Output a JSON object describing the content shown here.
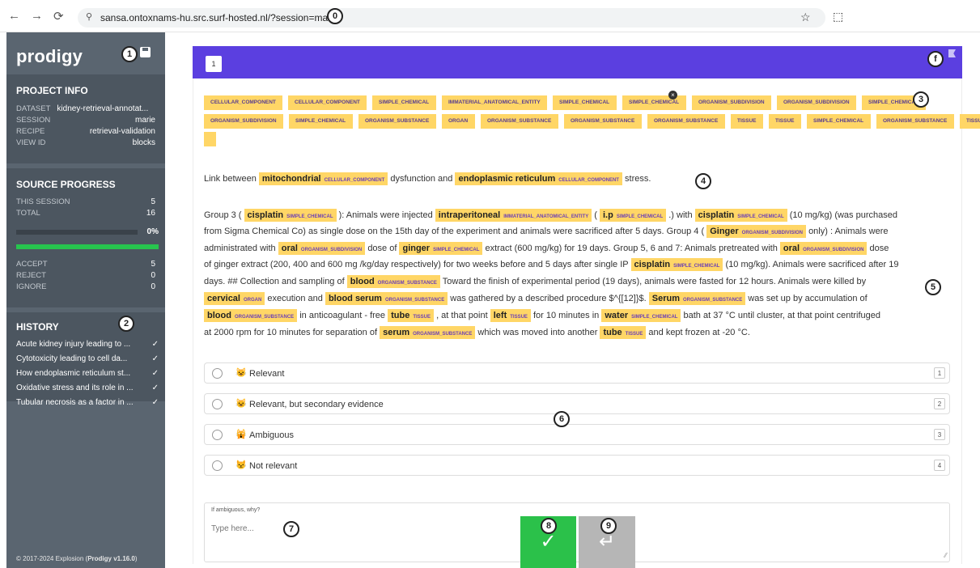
{
  "browser": {
    "url": "sansa.ontoxnams-hu.src.surf-hosted.nl/?session=marie",
    "back": "←",
    "forward": "→",
    "reload": "⟳",
    "site_icon": "⚲",
    "star": "☆",
    "ext": "⬚"
  },
  "markers": [
    "0",
    "1",
    "2",
    "3",
    "4",
    "5",
    "6",
    "7",
    "8",
    "9",
    "f"
  ],
  "sidebar": {
    "logo": "prodigy",
    "project_info": {
      "title": "PROJECT INFO",
      "rows": [
        {
          "k": "DATASET",
          "v": "kidney-retrieval-annotat..."
        },
        {
          "k": "SESSION",
          "v": "marie"
        },
        {
          "k": "RECIPE",
          "v": "retrieval-validation"
        },
        {
          "k": "VIEW ID",
          "v": "blocks"
        }
      ]
    },
    "source_progress": {
      "title": "SOURCE PROGRESS",
      "this_session_label": "THIS SESSION",
      "this_session": "5",
      "total_label": "TOTAL",
      "total": "16",
      "percent": "0%",
      "accept_label": "ACCEPT",
      "accept": "5",
      "reject_label": "REJECT",
      "reject": "0",
      "ignore_label": "IGNORE",
      "ignore": "0"
    },
    "history": {
      "title": "HISTORY",
      "items": [
        "Acute kidney injury leading to ...",
        "Cytotoxicity leading to cell da...",
        "How endoplasmic reticulum st...",
        "Oxidative stress and its role in ...",
        "Tubular necrosis as a factor in ..."
      ],
      "check": "✓"
    },
    "footer_prefix": "© 2017-2024 Explosion",
    "footer_version": "Prodigy v1.16.0"
  },
  "main": {
    "page": "1",
    "labels_row1": [
      "CELLULAR_COMPONENT",
      "CELLULAR_COMPONENT",
      "SIMPLE_CHEMICAL",
      "IMMATERIAL_ANATOMICAL_ENTITY",
      "SIMPLE_CHEMICAL",
      "SIMPLE_CHEMICAL",
      "ORGANISM_SUBDIVISION",
      "ORGANISM_SUBDIVISION",
      "SIMPLE_CHEMICAL"
    ],
    "labels_row2": [
      "ORGANISM_SUBDIVISION",
      "SIMPLE_CHEMICAL",
      "ORGANISM_SUBSTANCE",
      "ORGAN",
      "ORGANISM_SUBSTANCE",
      "ORGANISM_SUBSTANCE",
      "ORGANISM_SUBSTANCE",
      "TISSUE",
      "TISSUE",
      "SIMPLE_CHEMICAL",
      "ORGANISM_SUBSTANCE",
      "TISSUE"
    ],
    "close_glyph": "×",
    "title": {
      "t1": "Link between",
      "e1": "mitochondrial",
      "l1": "CELLULAR_COMPONENT",
      "t2": "dysfunction and",
      "e2": "endoplasmic reticulum",
      "l2": "CELLULAR_COMPONENT",
      "t3": "stress."
    },
    "body": {
      "l1": {
        "t1": "Group 3 (",
        "e1": "cisplatin",
        "b1": "SIMPLE_CHEMICAL",
        "t2": "): Animals were injected",
        "e2": "intraperitoneal",
        "b2": "IMMATERIAL_ANATOMICAL_ENTITY",
        "t3": "(",
        "e3": "i.p",
        "b3": "SIMPLE_CHEMICAL",
        "t4": ".) with",
        "e4": "cisplatin",
        "b4": "SIMPLE_CHEMICAL",
        "t5": "(10 mg/kg) (was purchased"
      },
      "l2": {
        "t1": "from Sigma Chemical Co) as single dose on the 15th day of the experiment and animals were sacrificed after 5 days. Group 4 (",
        "e1": "Ginger",
        "b1": "ORGANISM_SUBDIVISION",
        "t2": "only) : Animals were"
      },
      "l3": {
        "t1": "administrated with",
        "e1": "oral",
        "b1": "ORGANISM_SUBDIVISION",
        "t2": "dose of",
        "e2": "ginger",
        "b2": "SIMPLE_CHEMICAL",
        "t3": "extract (600 mg/kg) for 19 days. Group 5, 6 and 7: Animals pretreated with",
        "e3": "oral",
        "b3": "ORGANISM_SUBDIVISION",
        "t4": "dose"
      },
      "l4": {
        "t1": "of ginger extract (200, 400 and 600 mg /kg/day respectively) for two weeks before and 5 days after single IP",
        "e1": "cisplatin",
        "b1": "SIMPLE_CHEMICAL",
        "t2": "(10 mg/kg). Animals were sacrificed after 19"
      },
      "l5": {
        "t1": "days. ## Collection and sampling of",
        "e1": "blood",
        "b1": "ORGANISM_SUBSTANCE",
        "t2": "Toward the finish of experimental period (19 days), animals were fasted for 12 hours. Animals were killed by"
      },
      "l6": {
        "e1": "cervical",
        "b1": "ORGAN",
        "t1": "execution and",
        "e2": "blood serum",
        "b2": "ORGANISM_SUBSTANCE",
        "t2": "was gathered by a described procedure $^{[12]}$.",
        "e3": "Serum",
        "b3": "ORGANISM_SUBSTANCE",
        "t3": "was set up by accumulation of"
      },
      "l7": {
        "e1": "blood",
        "b1": "ORGANISM_SUBSTANCE",
        "t1": "in anticoagulant - free",
        "e2": "tube",
        "b2": "TISSUE",
        "t2": ", at that point",
        "e3": "left",
        "b3": "TISSUE",
        "t3": "for 10 minutes in",
        "e4": "water",
        "b4": "SIMPLE_CHEMICAL",
        "t4": "bath at 37 °C until cluster, at that point centrifuged"
      },
      "l8": {
        "t1": "at 2000 rpm for 10 minutes for separation of",
        "e1": "serum",
        "b1": "ORGANISM_SUBSTANCE",
        "t2": "which was moved into another",
        "e2": "tube",
        "b2": "TISSUE",
        "t3": "and kept frozen at -20 °C."
      }
    },
    "options": [
      {
        "emoji": "😺",
        "label": "Relevant",
        "key": "1"
      },
      {
        "emoji": "😺",
        "label": "Relevant, but secondary evidence",
        "key": "2"
      },
      {
        "emoji": "🙀",
        "label": "Ambiguous",
        "key": "3"
      },
      {
        "emoji": "😾",
        "label": "Not relevant",
        "key": "4"
      }
    ],
    "textarea_label": "If ambiguous, why?",
    "textarea_placeholder": "Type here...",
    "resize_glyph": "⁄⁄",
    "accept_glyph": "✓",
    "ignore_glyph": "↵"
  },
  "colors": {
    "header": "#5b3fe0",
    "sidebar": "#5a6570",
    "label": "#ffd666",
    "accept": "#2bc14a",
    "ignore": "#b6b6b6"
  }
}
